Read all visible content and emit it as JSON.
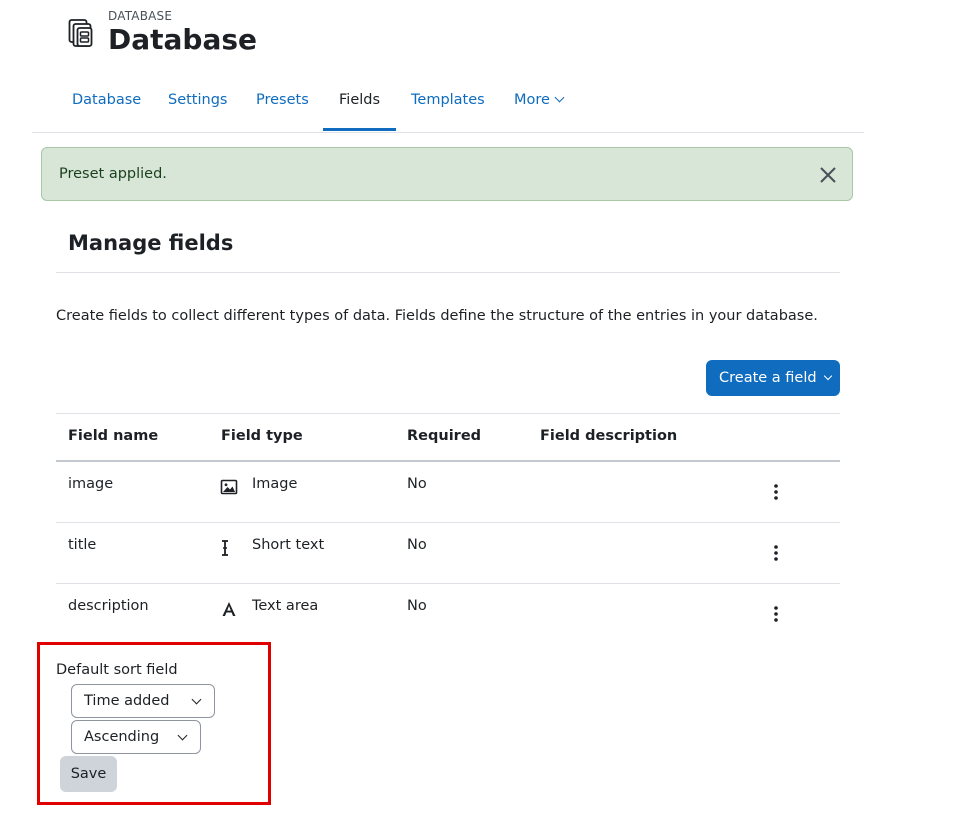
{
  "header": {
    "eyebrow": "DATABASE",
    "title": "Database",
    "icon": "database-icon"
  },
  "tabs": [
    {
      "label": "Database",
      "active": false
    },
    {
      "label": "Settings",
      "active": false
    },
    {
      "label": "Presets",
      "active": false
    },
    {
      "label": "Fields",
      "active": true
    },
    {
      "label": "Templates",
      "active": false
    },
    {
      "label": "More",
      "active": false,
      "dropdown": true
    }
  ],
  "alert": {
    "text": "Preset applied.",
    "close_icon": "close-icon"
  },
  "main": {
    "heading": "Manage fields",
    "intro": "Create fields to collect different types of data. Fields define the structure of the entries in your database.",
    "create_button": "Create a field"
  },
  "table": {
    "headers": [
      "Field name",
      "Field type",
      "Required",
      "Field description"
    ],
    "rows": [
      {
        "name": "image",
        "type": "Image",
        "type_icon": "image-icon",
        "required": "No",
        "description": ""
      },
      {
        "name": "title",
        "type": "Short text",
        "type_icon": "text-cursor-icon",
        "required": "No",
        "description": ""
      },
      {
        "name": "description",
        "type": "Text area",
        "type_icon": "font-icon",
        "required": "No",
        "description": ""
      }
    ]
  },
  "sort": {
    "label": "Default sort field",
    "field_value": "Time added",
    "order_value": "Ascending",
    "save_label": "Save"
  },
  "colors": {
    "accent": "#0f6cbf",
    "alert_bg": "#d7e6d7",
    "highlight": "#e00000"
  }
}
